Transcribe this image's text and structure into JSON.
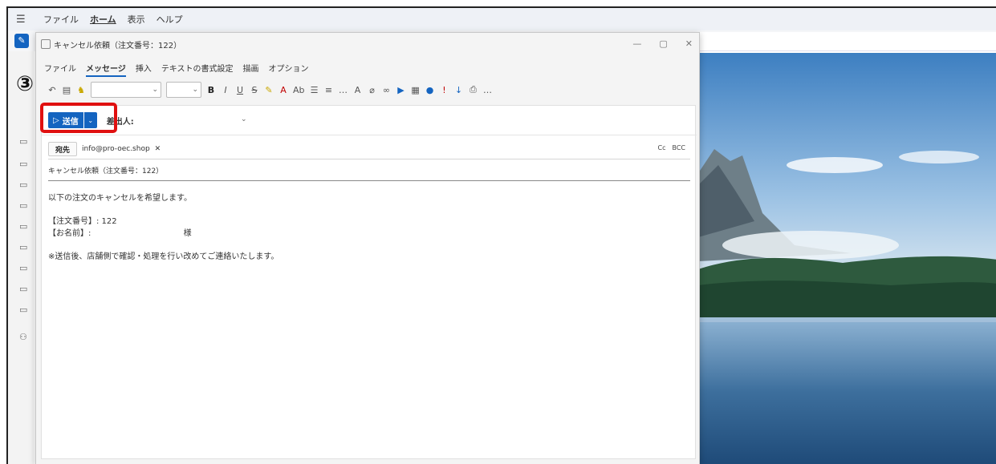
{
  "outer_menu": {
    "items": [
      "ファイル",
      "ホーム",
      "表示",
      "ヘルプ"
    ],
    "active_index": 1
  },
  "compose_window": {
    "title": "キャンセル依頼（注文番号：122）",
    "controls": {
      "minimize": "—",
      "maximize": "▢",
      "close": "✕"
    }
  },
  "ribbon_tabs": [
    "ファイル",
    "メッセージ",
    "挿入",
    "テキストの書式設定",
    "描画",
    "オプション"
  ],
  "ribbon_active_tab": "メッセージ",
  "toolbar": {
    "more_label": "…"
  },
  "send": {
    "label": "送信",
    "from_label": "差出人:"
  },
  "to": {
    "button_label": "宛先",
    "recipient": "info@pro-oec.shop",
    "cc_label": "Cc",
    "bcc_label": "BCC"
  },
  "subject": "キャンセル依頼（注文番号：122）",
  "body": {
    "line1": "以下の注文のキャンセルを希望します。",
    "order_line": "【注文番号】: 122",
    "name_label": "【お名前】:",
    "name_suffix": "様",
    "note": "※送信後、店舗側で確認・処理を行い改めてご連絡いたします。"
  },
  "annotation": {
    "step": "③",
    "color": "#e01010"
  },
  "colors": {
    "accent": "#1464c0"
  }
}
